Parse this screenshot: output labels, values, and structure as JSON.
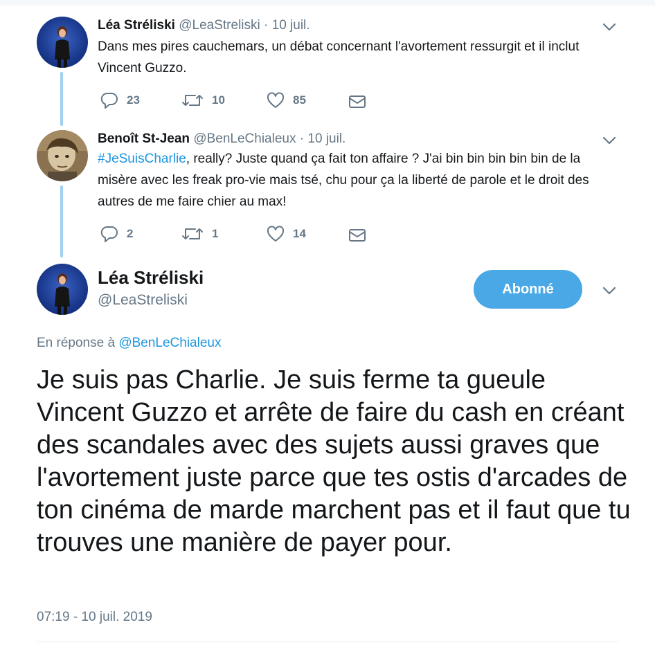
{
  "colors": {
    "accent": "#1b95e0",
    "follow_button": "#4aa8e6",
    "thread_line": "#9fd1f1",
    "muted": "#657786"
  },
  "tweet1": {
    "name": "Léa Stréliski",
    "handle": "@LeaStreliski",
    "separator": "·",
    "date": "10 juil.",
    "text": "Dans mes pires cauchemars, un débat concernant l'avortement ressurgit et il inclut Vincent Guzzo.",
    "actions": {
      "replies": "23",
      "retweets": "10",
      "likes": "85"
    }
  },
  "tweet2": {
    "name": "Benoît St-Jean",
    "handle": "@BenLeChialeux",
    "separator": "·",
    "date": "10 juil.",
    "hashtag": "#JeSuisCharlie",
    "text_rest": ", really? Juste quand ça fait ton affaire ?  J'ai bin bin bin bin bin de la misère avec les freak pro-vie mais tsé, chu pour ça la liberté de parole et le droit des autres de me faire chier au max!",
    "actions": {
      "replies": "2",
      "retweets": "1",
      "likes": "14"
    }
  },
  "main_tweet": {
    "name": "Léa Stréliski",
    "handle": "@LeaStreliski",
    "follow_label": "Abonné",
    "reply_prefix": "En réponse à",
    "reply_mention": "@BenLeChialeux",
    "text": "Je suis pas Charlie. Je suis ferme ta gueule Vincent Guzzo et arrête de faire du cash en créant des scandales avec des sujets aussi graves que l'avortement juste parce que tes ostis d'arcades de ton cinéma de marde marchent pas et il faut que tu trouves une manière de payer pour.",
    "timestamp": "07:19 - 10 juil. 2019"
  },
  "icons": [
    "reply-icon",
    "retweet-icon",
    "like-icon",
    "dm-icon",
    "chevron-down-icon"
  ]
}
